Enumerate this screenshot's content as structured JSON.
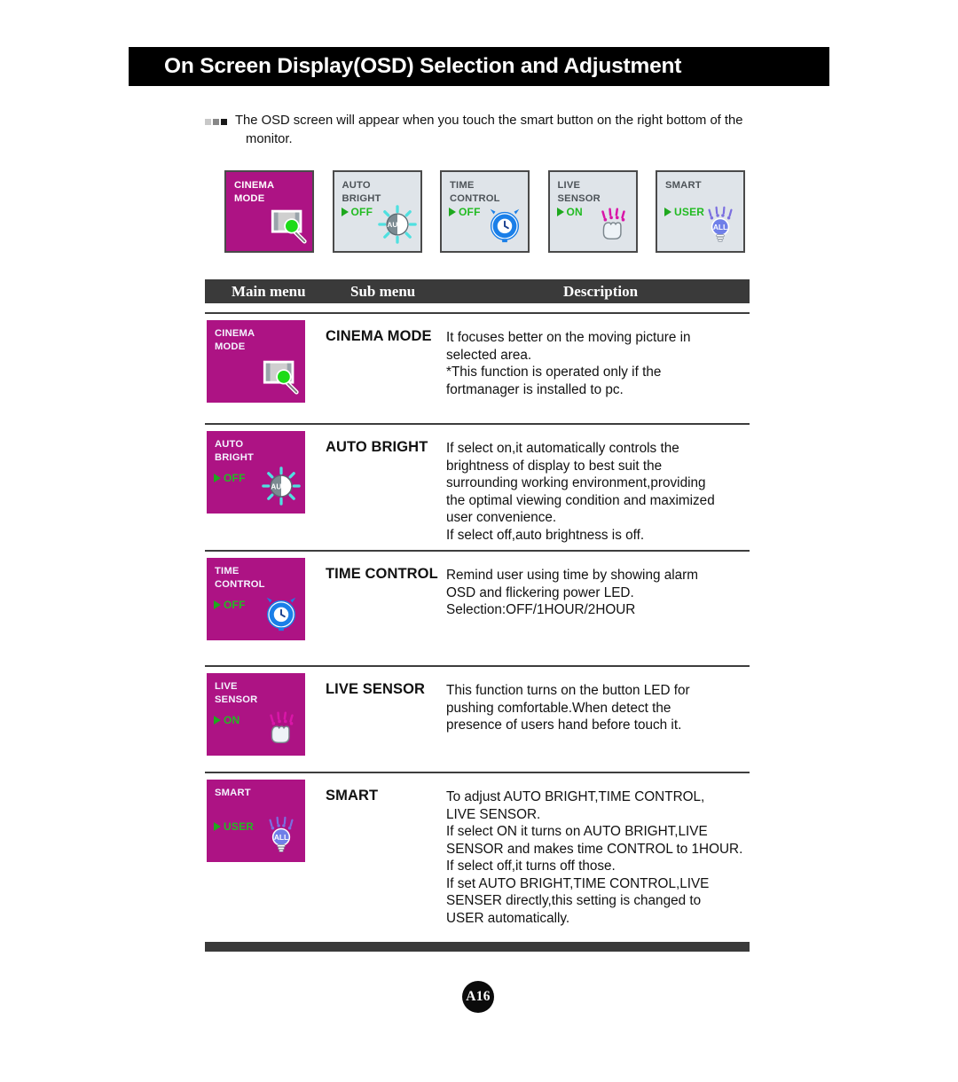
{
  "header": {
    "title": "On Screen Display(OSD) Selection and Adjustment"
  },
  "intro": {
    "line1": "The OSD screen will appear when you touch the smart button on the right bottom of the",
    "line2": "monitor.",
    "bullet_icon": "three-squares-bullet-icon"
  },
  "osd_tiles": [
    {
      "line1": "CINEMA",
      "line2": "MODE",
      "value": "",
      "style": "magenta",
      "glyph": "cinema-mode-glyph"
    },
    {
      "line1": "AUTO",
      "line2": "BRIGHT",
      "value": "OFF",
      "style": "light",
      "glyph": "auto-bright-glyph"
    },
    {
      "line1": "TIME",
      "line2": "CONTROL",
      "value": "OFF",
      "style": "light",
      "glyph": "time-control-glyph"
    },
    {
      "line1": "LIVE",
      "line2": "SENSOR",
      "value": "ON",
      "style": "light",
      "glyph": "live-sensor-glyph"
    },
    {
      "line1": "SMART",
      "line2": "",
      "value": "USER",
      "style": "light",
      "glyph": "smart-glyph"
    }
  ],
  "table": {
    "columns": {
      "main": "Main menu",
      "sub": "Sub menu",
      "desc": "Description"
    },
    "rows": [
      {
        "tile": {
          "line1": "CINEMA",
          "line2": "MODE",
          "value": "",
          "glyph": "cinema-mode-glyph"
        },
        "submenu": "CINEMA MODE",
        "description": [
          "It focuses better on the moving picture in",
          "selected area.",
          "*This function is operated only if the",
          "fortmanager is installed to pc."
        ]
      },
      {
        "tile": {
          "line1": "AUTO",
          "line2": "BRIGHT",
          "value": "OFF",
          "glyph": "auto-bright-glyph"
        },
        "submenu": "AUTO BRIGHT",
        "description": [
          "If select on,it automatically controls the",
          "brightness of display to best suit the",
          "surrounding working environment,providing",
          "the optimal viewing condition and maximized",
          "user convenience.",
          "If select off,auto brightness is off."
        ]
      },
      {
        "tile": {
          "line1": "TIME",
          "line2": "CONTROL",
          "value": "OFF",
          "glyph": "time-control-glyph"
        },
        "submenu": "TIME CONTROL",
        "description": [
          "Remind user using time by showing alarm",
          "OSD and flickering power LED.",
          "Selection:OFF/1HOUR/2HOUR"
        ]
      },
      {
        "tile": {
          "line1": "LIVE",
          "line2": "SENSOR",
          "value": "ON",
          "glyph": "live-sensor-glyph"
        },
        "submenu": "LIVE SENSOR",
        "description": [
          "This function turns on the button LED for",
          "pushing comfortable.When detect the",
          "presence of users hand before touch it."
        ]
      },
      {
        "tile": {
          "line1": "SMART",
          "line2": "",
          "value": "USER",
          "glyph": "smart-glyph"
        },
        "submenu": "SMART",
        "description": [
          "To adjust AUTO BRIGHT,TIME CONTROL,",
          "LIVE SENSOR.",
          "If select ON it turns on AUTO BRIGHT,LIVE",
          "SENSOR and makes time CONTROL to 1HOUR.",
          "If select off,it turns off those.",
          "If set AUTO BRIGHT,TIME CONTROL,LIVE",
          "SENSER directly,this setting is changed to",
          "USER automatically."
        ]
      }
    ]
  },
  "footer": {
    "page_number": "A16"
  },
  "colors": {
    "magenta": "#ad1384",
    "tile_light": "#dfe4e9",
    "header_band": "#3a3a3a",
    "value_green": "#22bb22",
    "title_bar": "#000000"
  }
}
